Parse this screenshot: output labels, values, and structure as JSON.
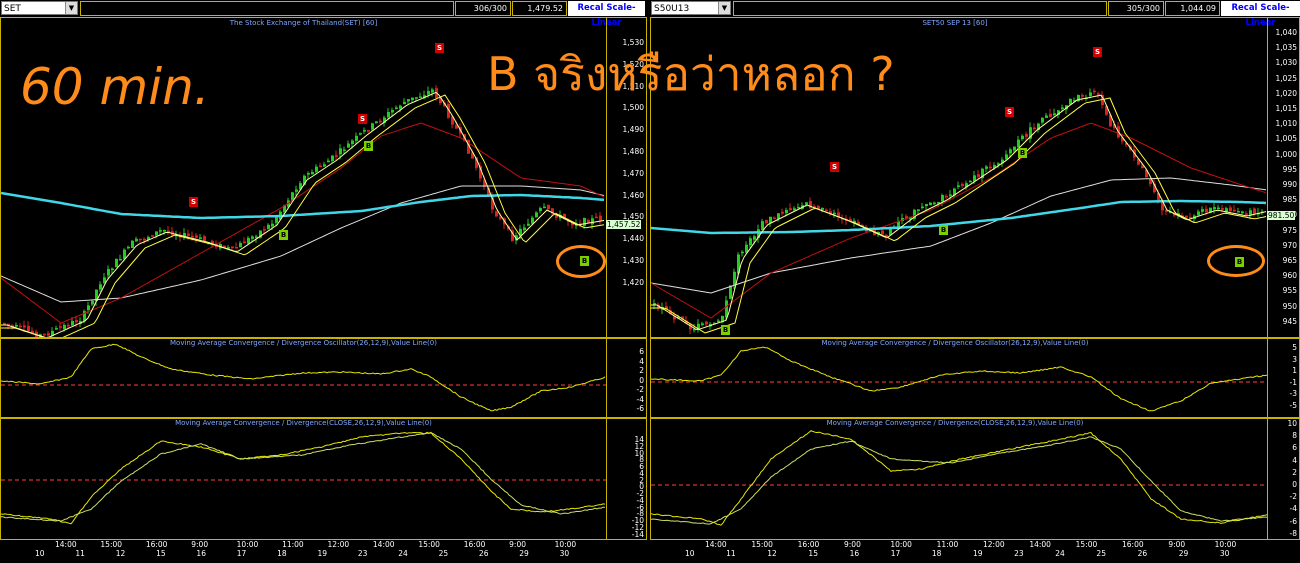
{
  "left": {
    "symbol": "SET",
    "count": "306/300",
    "last": "1,479.52",
    "recal_label": "Recal Scale-Linear",
    "price_title": "The Stock Exchange of Thailand(SET) [60]",
    "macd_osc_title": "Moving Average Convergence / Divergence Oscillator(26,12,9),Value Line(0)",
    "macd_title": "Moving Average Convergence / Divergence(CLOSE,26,12,9),Value Line(0)",
    "price_ticks": [
      "1,530",
      "1,520",
      "1,510",
      "1,500",
      "1,490",
      "1,480",
      "1,470",
      "1,460",
      "1,450",
      "1,440",
      "1,430",
      "1,420"
    ],
    "current_price": "1,457.52",
    "osc_ticks": [
      "6",
      "4",
      "2",
      "0",
      "-2",
      "-4",
      "-6"
    ],
    "macd_ticks": [
      "14",
      "12",
      "10",
      "8",
      "6",
      "4",
      "2",
      "0",
      "-2",
      "-4",
      "-6",
      "-8",
      "-10",
      "-12",
      "-14"
    ],
    "time_labels": [
      "14:00",
      "15:00",
      "16:00",
      "9:00",
      "10:00",
      "11:00",
      "12:00",
      "14:00",
      "15:00",
      "16:00",
      "9:00",
      "10:00"
    ],
    "date_labels": [
      "10",
      "11",
      "12",
      "15",
      "16",
      "17",
      "18",
      "19",
      "23",
      "24",
      "25",
      "26",
      "29",
      "30"
    ]
  },
  "right": {
    "symbol": "S50U13",
    "count": "305/300",
    "last": "1,044.09",
    "recal_label": "Recal Scale-Linear",
    "price_title": "SET50 SEP 13   [60]",
    "macd_osc_title": "Moving Average Convergence / Divergence Oscillator(26,12,9),Value Line(0)",
    "macd_title": "Moving Average Convergence / Divergence(CLOSE,26,12,9),Value Line(0)",
    "price_ticks": [
      "1,040",
      "1,035",
      "1,030",
      "1,025",
      "1,020",
      "1,015",
      "1,010",
      "1,005",
      "1,000",
      "995",
      "990",
      "985",
      "980",
      "975",
      "970",
      "965",
      "960",
      "955",
      "950",
      "945"
    ],
    "current_price": "981.50",
    "osc_ticks": [
      "5",
      "3",
      "1",
      "-1",
      "-3",
      "-5"
    ],
    "macd_ticks": [
      "10",
      "8",
      "6",
      "4",
      "2",
      "0",
      "-2",
      "-4",
      "-6",
      "-8"
    ],
    "time_labels": [
      "14:00",
      "15:00",
      "16:00",
      "9:00",
      "10:00",
      "11:00",
      "12:00",
      "14:00",
      "15:00",
      "16:00",
      "9:00",
      "10:00"
    ],
    "date_labels": [
      "10",
      "11",
      "12",
      "15",
      "16",
      "17",
      "18",
      "19",
      "23",
      "24",
      "25",
      "26",
      "29",
      "30"
    ]
  },
  "overlay": {
    "timeframe": "60 min.",
    "question": "B จริงหรือว่าหลอก ?"
  },
  "signals": {
    "sell": "S",
    "buy": "B"
  },
  "colors": {
    "accent": "#ff8c1a",
    "frame": "#c8b400",
    "ma_long": "#40d8e8",
    "ma_fast": "#ffff40",
    "ma_slow": "#c01010",
    "ma_200": "#e0e0e0",
    "bull_candle": "#22cc22",
    "bear_candle": "#dd2020"
  }
}
